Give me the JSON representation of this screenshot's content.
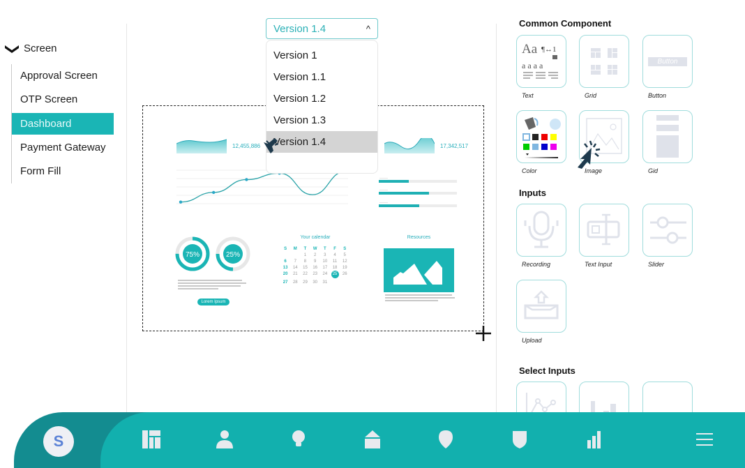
{
  "sidebar": {
    "root_label": "Screen",
    "items": [
      {
        "label": "Approval Screen",
        "active": false
      },
      {
        "label": "OTP Screen",
        "active": false
      },
      {
        "label": "Dashboard",
        "active": true
      },
      {
        "label": "Payment Gateway",
        "active": false
      },
      {
        "label": "Form Fill",
        "active": false
      }
    ]
  },
  "version_select": {
    "value": "Version 1.4",
    "caret": "^",
    "options": [
      "Version 1",
      "Version 1.1",
      "Version 1.2",
      "Version 1.3",
      "Version 1.4"
    ],
    "highlighted": "Version 1.4"
  },
  "preview": {
    "stat_left": "12,455,886",
    "stat_right": "17,342,517",
    "line_chart_points": [
      0.05,
      0.35,
      0.75,
      0.95,
      0.28,
      1.0
    ],
    "donuts": [
      {
        "label": "75%",
        "value": 0.75
      },
      {
        "label": "25%",
        "value": 0.25
      }
    ],
    "button_label": "Lorem Ipsum",
    "calendar": {
      "title": "Your calendar",
      "weekdays": [
        "S",
        "M",
        "T",
        "W",
        "T",
        "F",
        "S"
      ],
      "leading_blanks": 2,
      "days_in_month": 31,
      "today": 25
    },
    "resources_title": "Resources",
    "progress_bars": [
      0.38,
      0.64,
      0.52
    ]
  },
  "panel": {
    "sections": [
      {
        "title": "Common Component",
        "items": [
          "Text",
          "Grid",
          "Button",
          "Color",
          "Image",
          "Gid"
        ]
      },
      {
        "title": "Inputs",
        "items": [
          "Recording",
          "Text Input",
          "Slider",
          "Upload"
        ]
      },
      {
        "title": "Select Inputs",
        "items": [
          "",
          "",
          ""
        ]
      }
    ],
    "button_preview_text": "Button",
    "text_preview": {
      "big": "Aa",
      "small": "a a a a"
    }
  },
  "bottom_nav": {
    "avatar_letter": "S",
    "icons": [
      "dashboard-icon",
      "user-icon",
      "lightbulb-icon",
      "home-icon",
      "location-pin-icon",
      "shield-icon",
      "bar-chart-icon",
      "menu-icon"
    ]
  },
  "colors": {
    "accent": "#1ab5b5",
    "nav_bg": "#12b0ae",
    "nav_dark": "#138c90",
    "cursor": "#1e3a4d"
  }
}
